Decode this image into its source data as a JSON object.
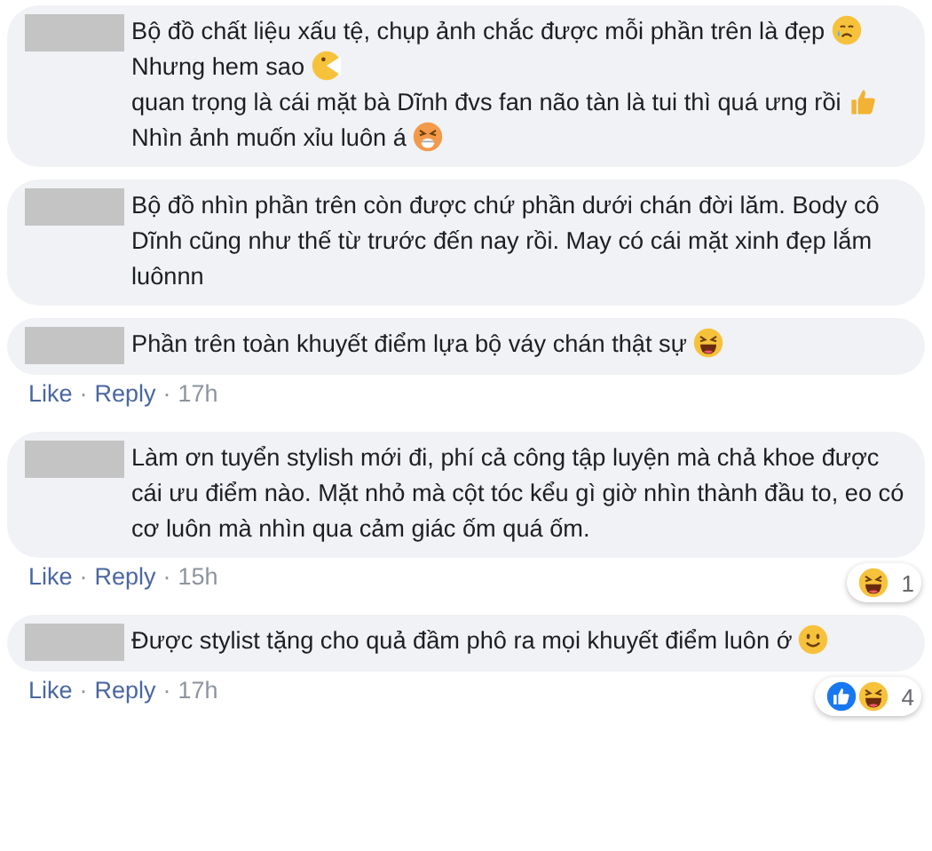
{
  "comments": [
    {
      "segments": [
        {
          "kind": "text",
          "text": "Bộ đồ chất liệu xấu tệ, chụp ảnh chắc được mỗi phần trên là đẹp"
        },
        {
          "kind": "sad"
        },
        {
          "kind": "text",
          "text": " Nhưng hem sao "
        },
        {
          "kind": "pac"
        },
        {
          "kind": "text",
          "text": " quan trọng là cái mặt bà Dĩnh đvs fan não tàn là tui thì quá ưng rồi "
        },
        {
          "kind": "thumb"
        },
        {
          "kind": "text",
          "text": " Nhìn ảnh muốn xỉu luôn á"
        },
        {
          "kind": "weary"
        }
      ]
    },
    {
      "segments": [
        {
          "kind": "text",
          "text": "Bộ đồ nhìn phần trên còn được chứ phần dưới chán đời lăm. Body cô Dĩnh cũng như thế từ trước đến nay rồi. May có cái mặt xinh đẹp lắm luônnn"
        }
      ]
    },
    {
      "segments": [
        {
          "kind": "text",
          "text": "Phần trên toàn khuyết điểm lựa bộ váy chán thật sự "
        },
        {
          "kind": "laugh"
        }
      ],
      "footer": {
        "like": "Like",
        "sep1": "·",
        "reply": "Reply",
        "sep2": "·",
        "time": "17h"
      }
    },
    {
      "segments": [
        {
          "kind": "text",
          "text": "Làm ơn tuyển stylish mới đi, phí cả công tập luyện mà chả khoe được cái ưu điểm nào. Mặt nhỏ mà cột tóc kểu gì giờ nhìn thành đầu to, eo có cơ luôn mà nhìn qua cảm giác ốm quá ốm."
        }
      ],
      "footer": {
        "like": "Like",
        "sep1": "·",
        "reply": "Reply",
        "sep2": "·",
        "time": "15h"
      },
      "reactions": {
        "icons": [
          {
            "kind": "laugh"
          }
        ],
        "count": "1"
      }
    },
    {
      "segments": [
        {
          "kind": "text",
          "text": "Được stylist tặng cho quả đầm phô ra mọi khuyết điểm luôn ớ "
        },
        {
          "kind": "smile"
        }
      ],
      "footer": {
        "like": "Like",
        "sep1": "·",
        "reply": "Reply",
        "sep2": "·",
        "time": "17h"
      },
      "reactions": {
        "icons": [
          {
            "kind": "like"
          },
          {
            "kind": "laugh"
          }
        ],
        "count": "4"
      }
    }
  ]
}
